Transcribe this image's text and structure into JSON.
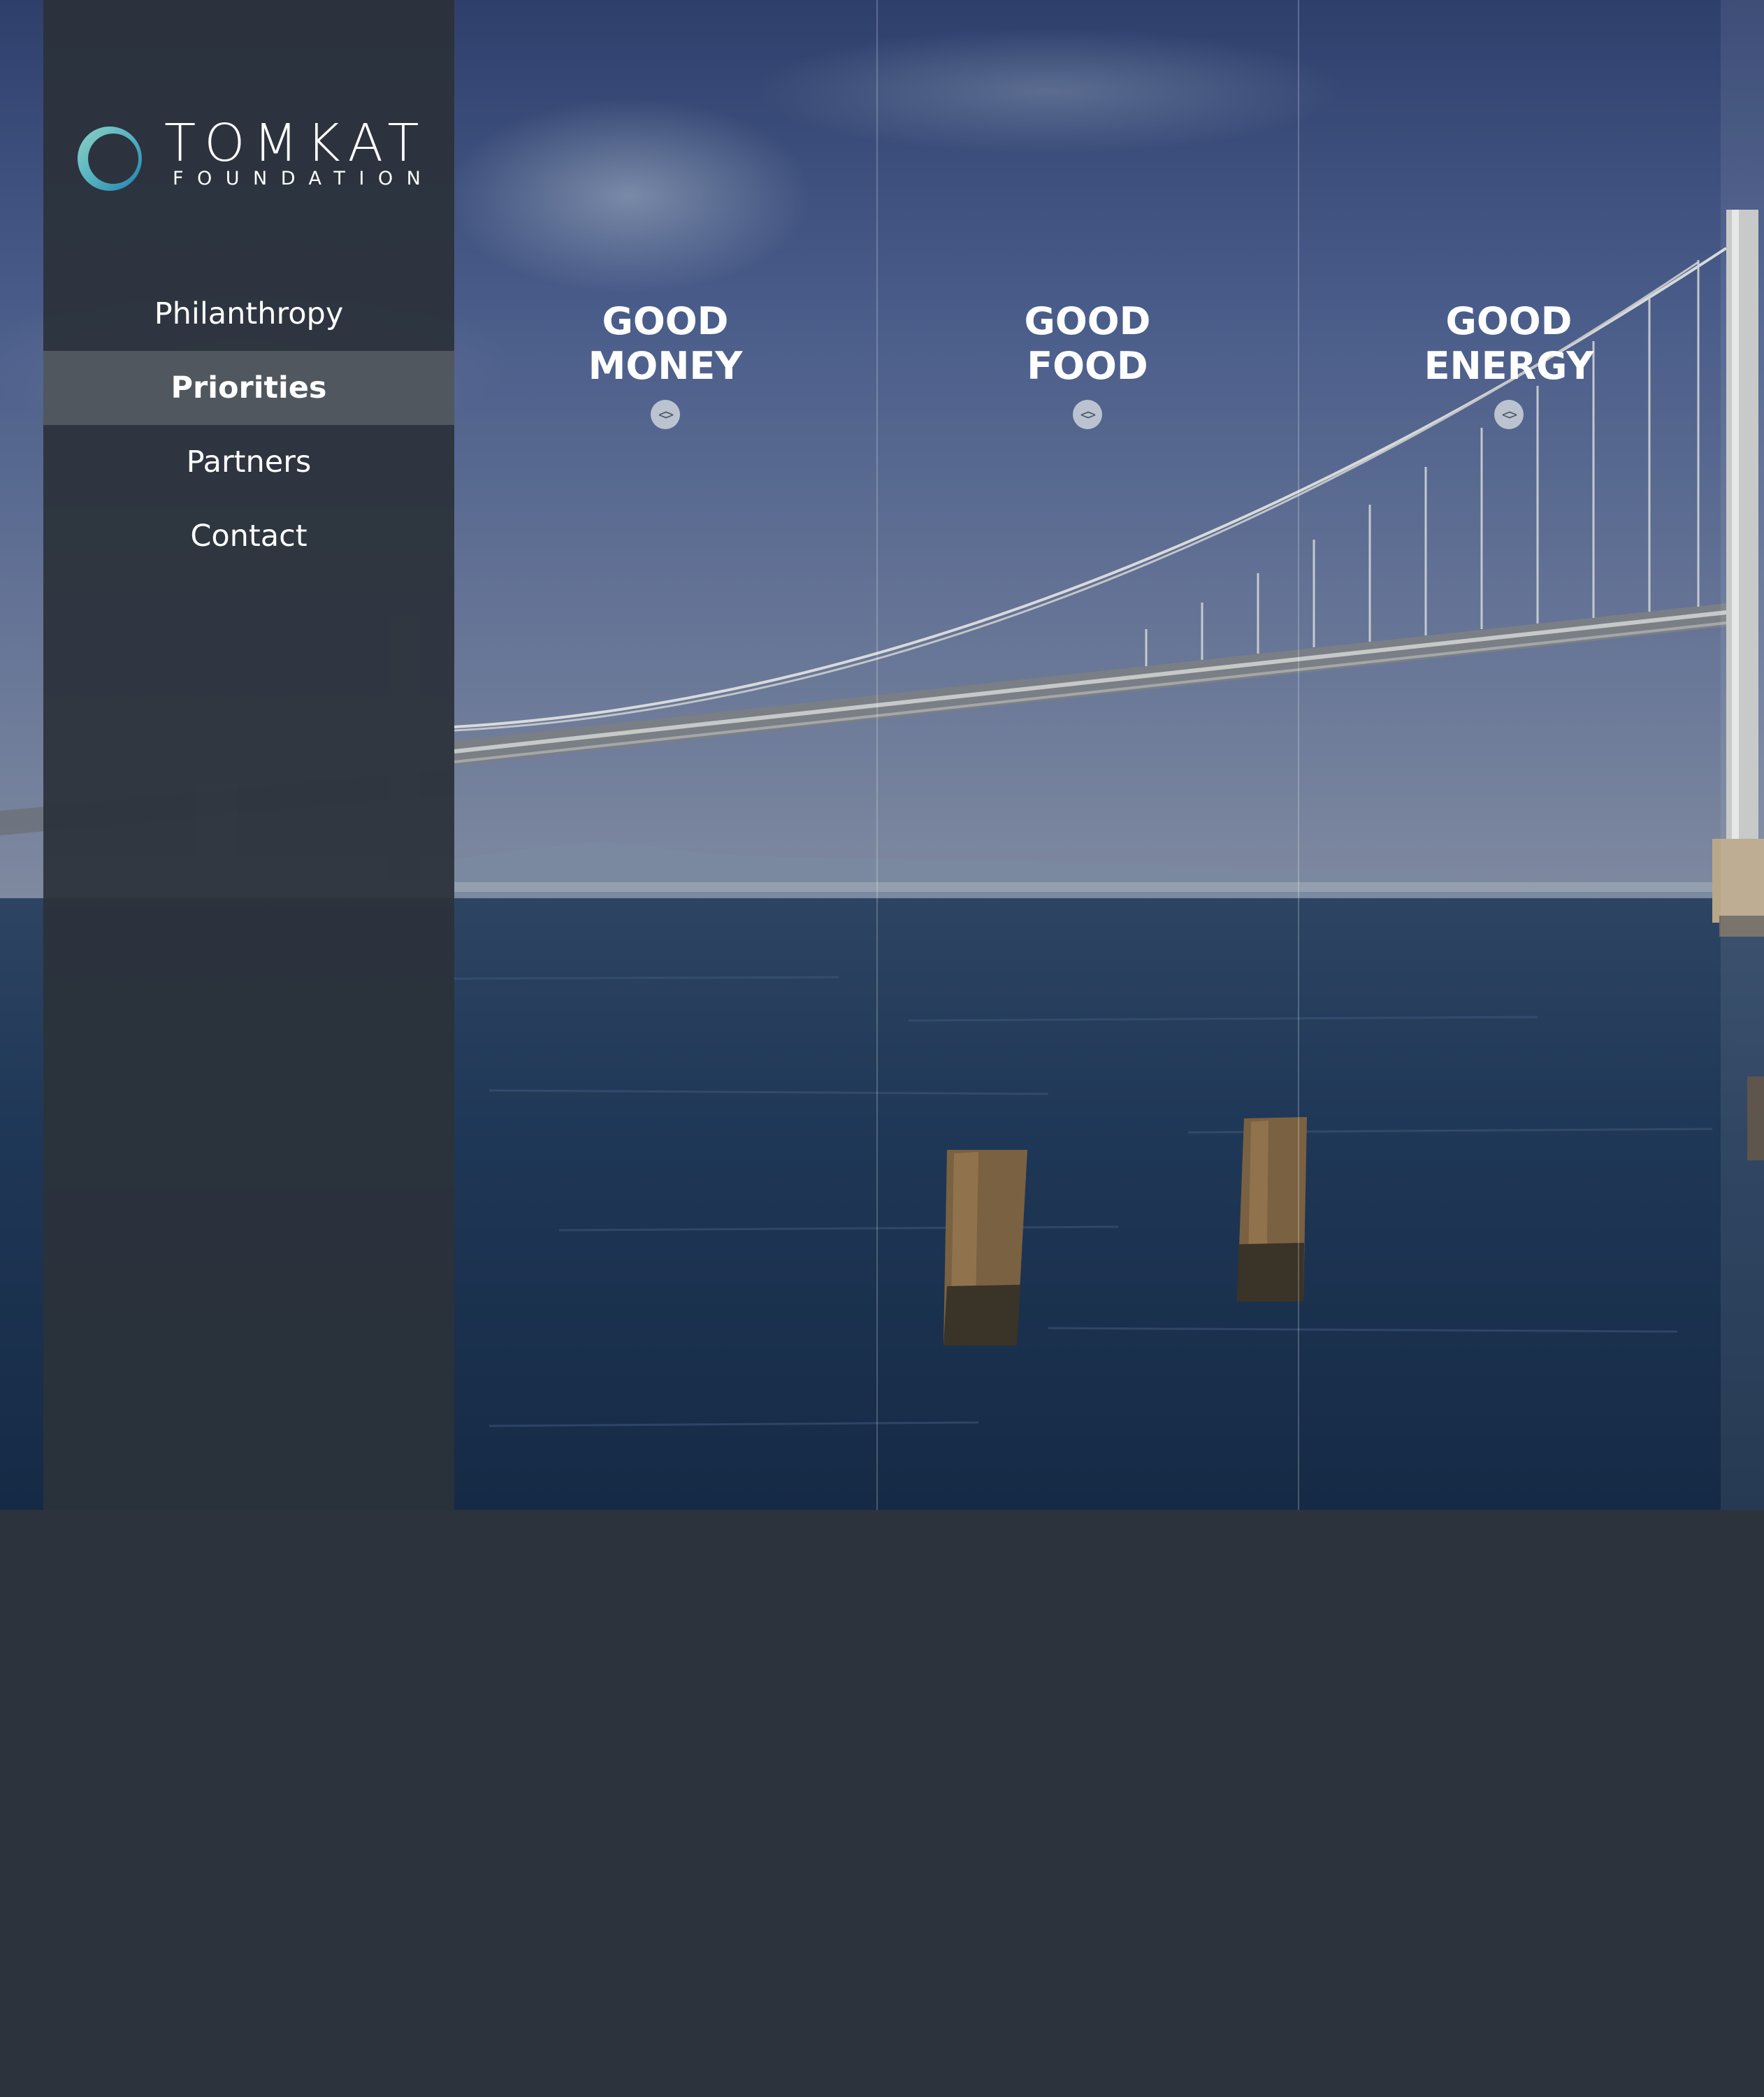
{
  "brand": {
    "name": "TOMKAT",
    "subtitle": "FOUNDATION",
    "ring_colors": [
      "#7fc7c0",
      "#2f8fb0"
    ]
  },
  "nav": {
    "items": [
      {
        "label": "Philanthropy",
        "active": false
      },
      {
        "label": "Priorities",
        "active": true
      },
      {
        "label": "Partners",
        "active": false
      },
      {
        "label": "Contact",
        "active": false
      }
    ]
  },
  "priorities": [
    {
      "line1": "GOOD",
      "line2": "MONEY",
      "toggle": "<>"
    },
    {
      "line1": "GOOD",
      "line2": "FOOD",
      "toggle": "<>"
    },
    {
      "line1": "GOOD",
      "line2": "ENERGY",
      "toggle": "<>"
    }
  ],
  "colors": {
    "panel": "#2b313a",
    "active_nav": "#5c636a",
    "page_background": "#2c333d",
    "text": "#ffffff"
  }
}
